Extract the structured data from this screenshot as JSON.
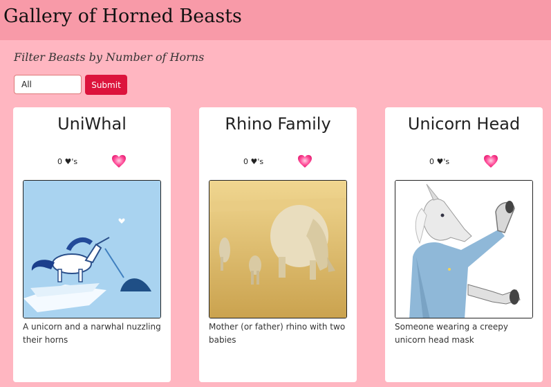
{
  "header": {
    "title": "Gallery of Horned Beasts"
  },
  "filter": {
    "label": "Filter Beasts by Number of Horns",
    "selected": "All",
    "submit_label": "Submit"
  },
  "colors": {
    "page_bg": "#ffb6c1",
    "header_bg": "#f89aa8",
    "submit_bg": "#dc143c",
    "heart": "#ff3f8f"
  },
  "cards": [
    {
      "title": "UniWhal",
      "likes": "0 ♥'s",
      "heart_icon": "heart-icon",
      "image": "unicorn and narwhal illustration",
      "description": "A unicorn and a narwhal nuzzling their horns"
    },
    {
      "title": "Rhino Family",
      "likes": "0 ♥'s",
      "heart_icon": "heart-icon",
      "image": "rhino with two babies photo",
      "description": "Mother (or father) rhino with two babies"
    },
    {
      "title": "Unicorn Head",
      "likes": "0 ♥'s",
      "heart_icon": "heart-icon",
      "image": "person in unicorn mask photo",
      "description": "Someone wearing a creepy unicorn head mask"
    }
  ]
}
